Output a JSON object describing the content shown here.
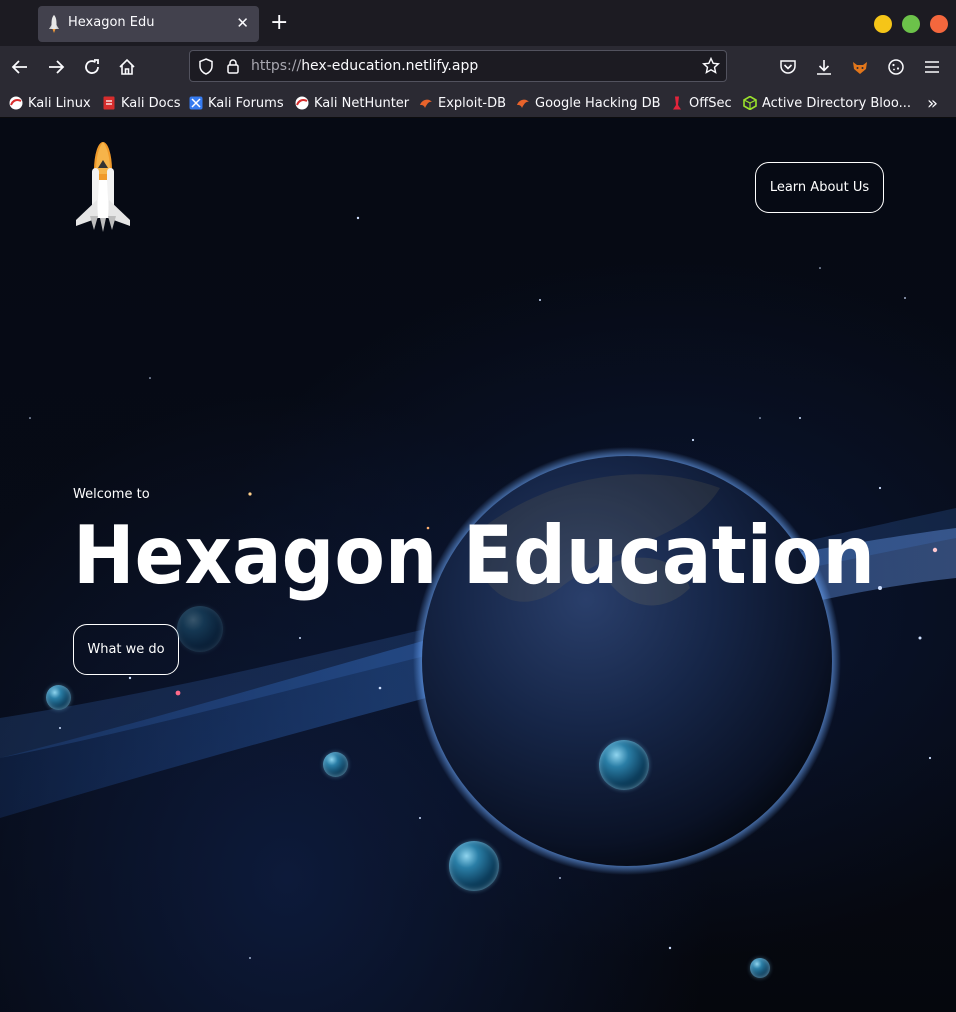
{
  "browser": {
    "tab": {
      "title": "Hexagon Edu",
      "close_glyph": "✕",
      "favicon": "rocket-icon"
    },
    "new_tab_glyph": "+",
    "window_buttons": {
      "minimize": "#f5c518",
      "maximize": "#6cc24a",
      "close": "#f4673d"
    },
    "url": {
      "protocol": "https://",
      "host": "hex-education.netlify.app"
    },
    "bookmarks": [
      {
        "label": "Kali Linux",
        "icon": "kali-icon"
      },
      {
        "label": "Kali Docs",
        "icon": "kali-docs-icon"
      },
      {
        "label": "Kali Forums",
        "icon": "kali-forums-icon"
      },
      {
        "label": "Kali NetHunter",
        "icon": "kali-icon"
      },
      {
        "label": "Exploit-DB",
        "icon": "exploit-db-icon"
      },
      {
        "label": "Google Hacking DB",
        "icon": "exploit-db-icon"
      },
      {
        "label": "OffSec",
        "icon": "offsec-icon"
      },
      {
        "label": "Active Directory Bloo...",
        "icon": "bloodhound-icon"
      }
    ],
    "bookmarks_overflow_glyph": "»"
  },
  "page": {
    "header": {
      "learn_button": "Learn About Us",
      "logo": "space-shuttle-logo"
    },
    "hero": {
      "welcome": "Welcome to",
      "title": "Hexagon Education",
      "cta_button": "What we do"
    }
  }
}
